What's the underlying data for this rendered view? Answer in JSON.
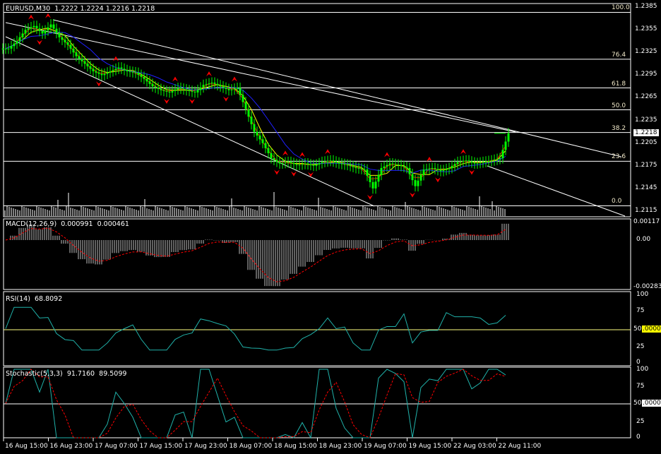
{
  "main": {
    "symbol_title": "EURUSD,M30",
    "ohlc": "1.2222 1.2224 1.2216 1.2218",
    "current_price": "1.2218",
    "price_axis": [
      "1.2385",
      "1.2355",
      "1.2325",
      "1.2295",
      "1.2265",
      "1.2235",
      "1.2205",
      "1.2175",
      "1.2145",
      "1.2115"
    ],
    "fib_levels": [
      {
        "label": "100.0",
        "price": 1.2378
      },
      {
        "label": "76.4",
        "price": 1.2316
      },
      {
        "label": "61.8",
        "price": 1.2278
      },
      {
        "label": "50.0",
        "price": 1.2249
      },
      {
        "label": "38.2",
        "price": 1.2219
      },
      {
        "label": "23.6",
        "price": 1.2181
      },
      {
        "label": "0.0",
        "price": 1.2122
      }
    ]
  },
  "macd": {
    "title": "MACD(12,26,9)",
    "value1": "0.000991",
    "value2": "0.000461",
    "axis": [
      "0.00117",
      "0.00",
      "-0.00283"
    ]
  },
  "rsi": {
    "title": "RSI(14)",
    "value": "68.8092",
    "axis": [
      "100",
      "75",
      "50",
      "25",
      "0"
    ],
    "level_tag": ".0000"
  },
  "stoch": {
    "title": "Stochastic(5,3,3)",
    "value1": "91.7160",
    "value2": "89.5099",
    "axis": [
      "100",
      "75",
      "50",
      "25",
      "0"
    ],
    "level_tag": ".0000"
  },
  "time_axis": [
    "16 Aug 15:00",
    "16 Aug 23:00",
    "17 Aug 07:00",
    "17 Aug 15:00",
    "17 Aug 23:00",
    "18 Aug 07:00",
    "18 Aug 15:00",
    "18 Aug 23:00",
    "19 Aug 07:00",
    "19 Aug 15:00",
    "22 Aug 03:00",
    "22 Aug 11:00"
  ],
  "colors": {
    "price": "#00ff00",
    "ma_fast": "#ff0000",
    "ma_mid": "#ffff00",
    "ma_slow": "#2020ff",
    "fractal": "#ff0000",
    "rsi": "#20b2aa",
    "stoch_signal": "#ff0000",
    "macd_hist": "#c0c0c0"
  },
  "chart_data": {
    "type": "line",
    "title": "EURUSD,M30",
    "ylim": [
      1.211,
      1.2388
    ],
    "closes": [
      1.233,
      1.234,
      1.2355,
      1.236,
      1.235,
      1.2362,
      1.2345,
      1.2335,
      1.232,
      1.231,
      1.23,
      1.2295,
      1.23,
      1.2305,
      1.23,
      1.2298,
      1.229,
      1.228,
      1.2275,
      1.2272,
      1.2278,
      1.2275,
      1.2272,
      1.2282,
      1.2285,
      1.228,
      1.2275,
      1.2278,
      1.225,
      1.222,
      1.2205,
      1.2185,
      1.2178,
      1.218,
      1.2176,
      1.2178,
      1.2175,
      1.218,
      1.2182,
      1.2178,
      1.2176,
      1.2172,
      1.217,
      1.2145,
      1.2172,
      1.2178,
      1.2176,
      1.2172,
      1.2148,
      1.217,
      1.2172,
      1.2168,
      1.2172,
      1.218,
      1.2182,
      1.2178,
      1.218,
      1.2182,
      1.2185,
      1.2218
    ]
  }
}
